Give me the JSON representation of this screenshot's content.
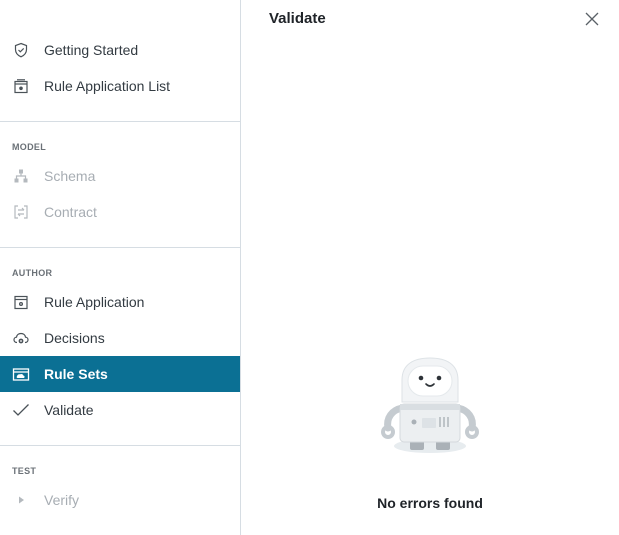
{
  "sidebar": {
    "top_items": [
      {
        "label": "Getting Started",
        "icon": "shield-check-icon"
      },
      {
        "label": "Rule Application List",
        "icon": "rule-app-list-icon"
      }
    ],
    "sections": {
      "model": {
        "header": "MODEL",
        "items": [
          {
            "label": "Schema",
            "icon": "schema-icon",
            "disabled": true
          },
          {
            "label": "Contract",
            "icon": "contract-icon",
            "disabled": true
          }
        ]
      },
      "author": {
        "header": "AUTHOR",
        "items": [
          {
            "label": "Rule Application",
            "icon": "rule-application-icon"
          },
          {
            "label": "Decisions",
            "icon": "decisions-icon"
          },
          {
            "label": "Rule Sets",
            "icon": "rule-sets-icon",
            "active": true
          },
          {
            "label": "Validate",
            "icon": "checkmark-icon"
          }
        ]
      },
      "test": {
        "header": "TEST",
        "items": [
          {
            "label": "Verify",
            "icon": "play-icon",
            "disabled": true
          }
        ]
      }
    }
  },
  "panel": {
    "title": "Validate",
    "close_icon": "close-icon",
    "empty_illustration": "robot-icon",
    "empty_message": "No errors found"
  },
  "colors": {
    "active_bg": "#0b7094",
    "divider": "#d6dde3",
    "text": "#333b42",
    "disabled_text": "#a7adb3"
  }
}
